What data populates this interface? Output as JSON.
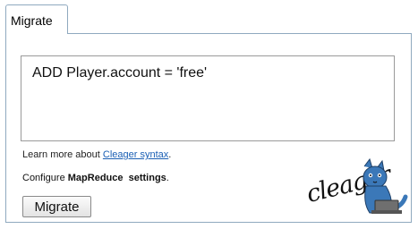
{
  "tabs": [
    {
      "label": "Migrate",
      "active": true
    }
  ],
  "editor": {
    "code": "ADD Player.account = 'free'"
  },
  "help": {
    "learn_prefix": "Learn more about ",
    "learn_link": "Cleager syntax",
    "learn_suffix": "."
  },
  "configure": {
    "prefix": "Configure ",
    "bold": "MapReduce  settings",
    "suffix": "."
  },
  "actions": {
    "migrate_label": "Migrate"
  },
  "logo": {
    "text": "cleager"
  },
  "colors": {
    "panel_border": "#8fa9bf",
    "link": "#1a5fb4",
    "cat": "#3b78b8"
  }
}
